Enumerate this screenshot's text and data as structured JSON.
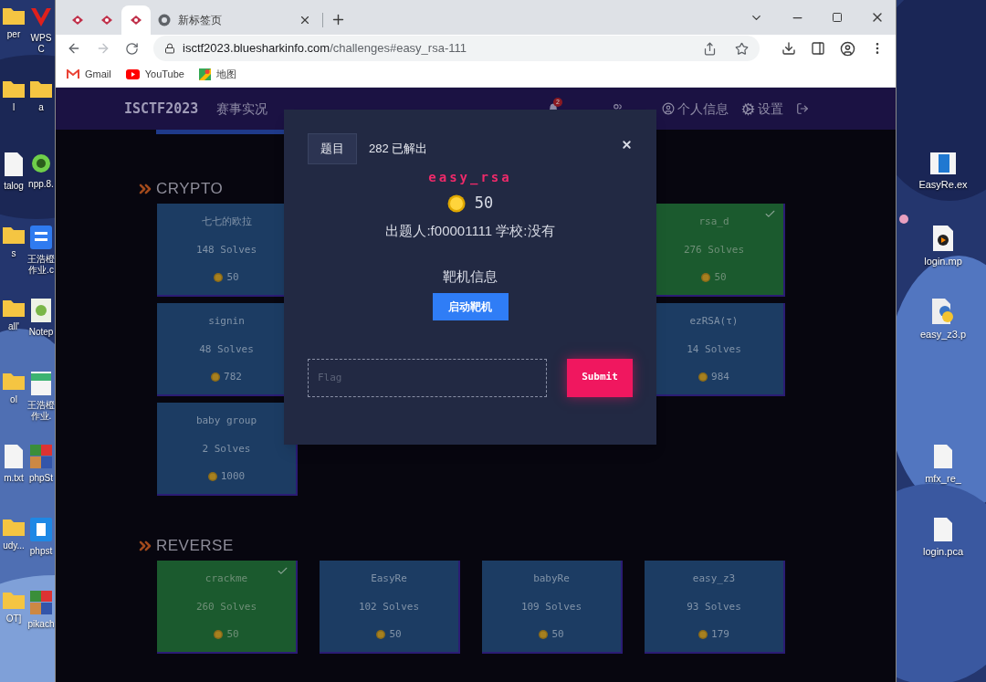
{
  "desktop": {
    "left_icons": [
      {
        "kind": "folder",
        "label": "per"
      },
      {
        "kind": "wps",
        "label": "WPS C"
      },
      {
        "kind": "folder",
        "label": "l"
      },
      {
        "kind": "folder",
        "label": "a"
      },
      {
        "kind": "file",
        "label": "talog"
      },
      {
        "kind": "npp",
        "label": "npp.8."
      },
      {
        "kind": "folder",
        "label": "s"
      },
      {
        "kind": "word",
        "label": "王浩橙作业.c"
      },
      {
        "kind": "folder",
        "label": "all'"
      },
      {
        "kind": "notepad",
        "label": "Notep"
      },
      {
        "kind": "folder",
        "label": "ol"
      },
      {
        "kind": "pdf",
        "label": "王浩橙作业."
      },
      {
        "kind": "file",
        "label": "m.txt"
      },
      {
        "kind": "blocks",
        "label": "phpSt"
      },
      {
        "kind": "folder",
        "label": "udy..."
      },
      {
        "kind": "tile",
        "label": "phpst"
      },
      {
        "kind": "folder",
        "label": "OT]"
      },
      {
        "kind": "blocks",
        "label": "pikach"
      }
    ],
    "right_icons": [
      {
        "kind": "exe",
        "label": "EasyRe.ex"
      },
      {
        "kind": "media",
        "label": "login.mp"
      },
      {
        "kind": "python",
        "label": "easy_z3.p"
      },
      {
        "kind": "file",
        "label": "mfx_re_"
      },
      {
        "kind": "file",
        "label": "login.pca"
      }
    ]
  },
  "browser": {
    "tabs": [
      {
        "kind": "site",
        "selected": false
      },
      {
        "kind": "site",
        "selected": false
      },
      {
        "kind": "site",
        "selected": true
      },
      {
        "kind": "newtab",
        "title": "新标签页",
        "selected": false
      }
    ],
    "address": {
      "host": "isctf2023.bluesharkinfo.com",
      "path": "/challenges#easy_rsa-111"
    },
    "bookmarks": [
      {
        "kind": "gmail",
        "label": "Gmail"
      },
      {
        "kind": "youtube",
        "label": "YouTube"
      },
      {
        "kind": "maps",
        "label": "地图"
      }
    ]
  },
  "site": {
    "brand": "ISCTF2023",
    "nav_left": [
      "赛事实况"
    ],
    "nav_right": [
      {
        "kind": "bell",
        "badge": "2"
      },
      {
        "kind": "users"
      },
      {
        "kind": "user",
        "label": "个人信息"
      },
      {
        "kind": "gears",
        "label": "设置"
      },
      {
        "kind": "logout"
      }
    ],
    "categories": [
      {
        "name": "CRYPTO",
        "cards": [
          {
            "name": "七七的欧拉",
            "solves": "148 Solves",
            "points": "50",
            "solved": false
          },
          {
            "name": "rsa_d",
            "solves": "276 Solves",
            "points": "50",
            "solved": true
          },
          {
            "name": "signin",
            "solves": "48 Solves",
            "points": "782",
            "solved": false
          },
          {
            "name": "ezRSA(τ)",
            "solves": "14 Solves",
            "points": "984",
            "solved": false
          },
          {
            "name": "baby group",
            "solves": "2 Solves",
            "points": "1000",
            "solved": false
          }
        ]
      },
      {
        "name": "REVERSE",
        "cards": [
          {
            "name": "crackme",
            "solves": "260 Solves",
            "points": "50",
            "solved": true
          },
          {
            "name": "EasyRe",
            "solves": "102 Solves",
            "points": "50",
            "solved": false
          },
          {
            "name": "babyRe",
            "solves": "109 Solves",
            "points": "50",
            "solved": false
          },
          {
            "name": "easy_z3",
            "solves": "93 Solves",
            "points": "179",
            "solved": false
          }
        ]
      }
    ]
  },
  "modal": {
    "tab": {
      "label": "题目",
      "selected": true
    },
    "solves": "282 已解出",
    "title": "easy_rsa",
    "points": "50",
    "author_line": "出题人:f00001111 学校:没有",
    "section": "靶机信息",
    "start_button": "启动靶机",
    "flag_placeholder": "Flag",
    "submit": "Submit"
  }
}
